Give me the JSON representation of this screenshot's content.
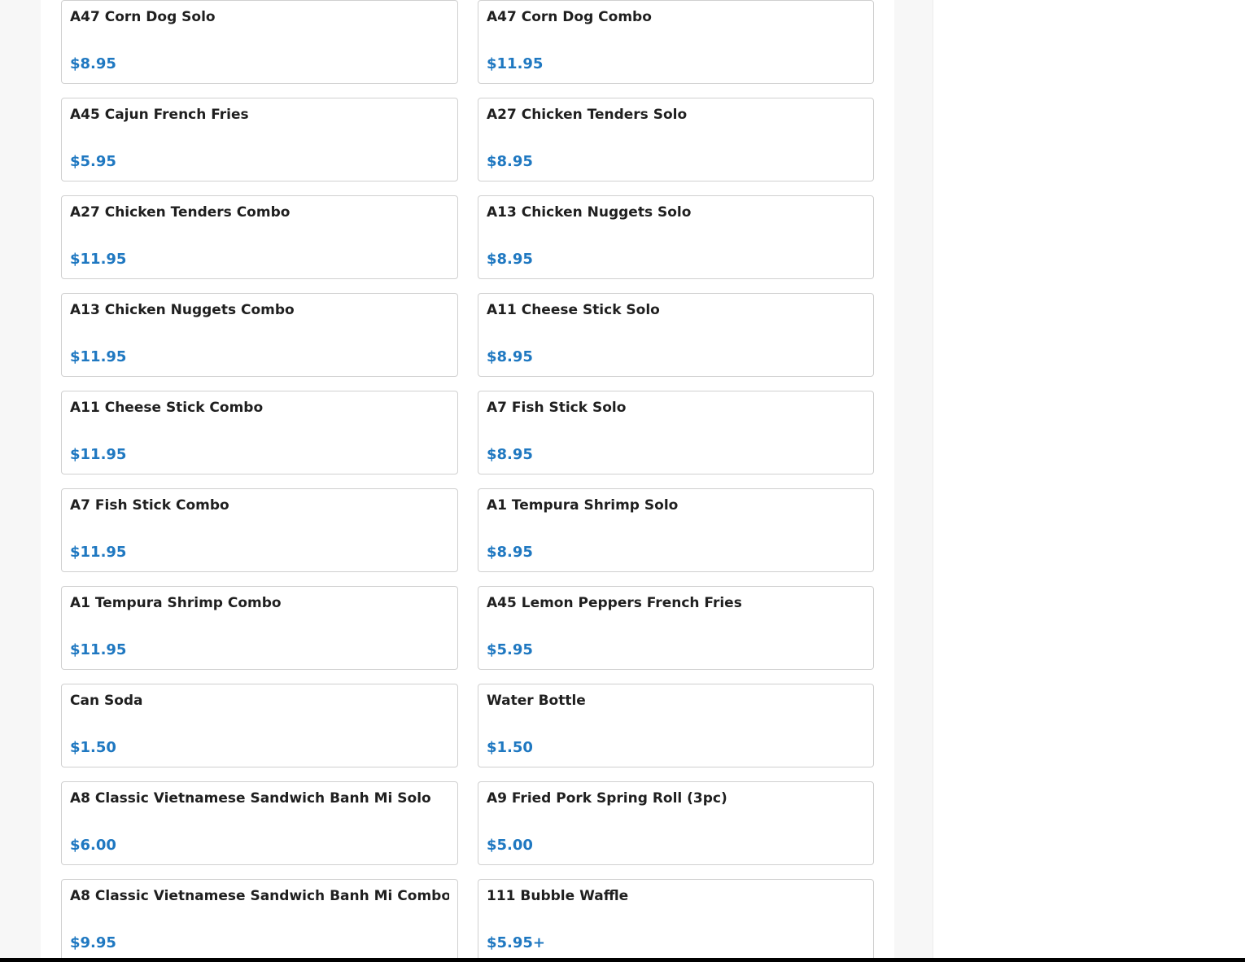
{
  "menu": {
    "items": [
      {
        "name": "A47 Corn Dog Solo",
        "price": "$8.95"
      },
      {
        "name": "A47 Corn Dog Combo",
        "price": "$11.95"
      },
      {
        "name": "A45 Cajun French Fries",
        "price": "$5.95"
      },
      {
        "name": "A27 Chicken Tenders Solo",
        "price": "$8.95"
      },
      {
        "name": "A27 Chicken Tenders Combo",
        "price": "$11.95"
      },
      {
        "name": "A13 Chicken Nuggets Solo",
        "price": "$8.95"
      },
      {
        "name": "A13 Chicken Nuggets Combo",
        "price": "$11.95"
      },
      {
        "name": "A11 Cheese Stick Solo",
        "price": "$8.95"
      },
      {
        "name": "A11 Cheese Stick Combo",
        "price": "$11.95"
      },
      {
        "name": "A7 Fish Stick Solo",
        "price": "$8.95"
      },
      {
        "name": "A7 Fish Stick Combo",
        "price": "$11.95"
      },
      {
        "name": "A1 Tempura Shrimp Solo",
        "price": "$8.95"
      },
      {
        "name": "A1 Tempura Shrimp Combo",
        "price": "$11.95"
      },
      {
        "name": "A45 Lemon Peppers French Fries",
        "price": "$5.95"
      },
      {
        "name": "Can Soda",
        "price": "$1.50"
      },
      {
        "name": "Water Bottle",
        "price": "$1.50"
      },
      {
        "name": "A8 Classic Vietnamese Sandwich Banh Mi Solo",
        "price": "$6.00"
      },
      {
        "name": "A9 Fried Pork Spring Roll (3pc)",
        "price": "$5.00"
      },
      {
        "name": "A8 Classic Vietnamese Sandwich Banh Mi Combo",
        "price": "$9.95"
      },
      {
        "name": "111 Bubble Waffle",
        "price": "$5.95+"
      }
    ]
  },
  "colors": {
    "price": "#1f78c1",
    "name": "#1f1f1f",
    "card_border": "#d0d0d0"
  }
}
